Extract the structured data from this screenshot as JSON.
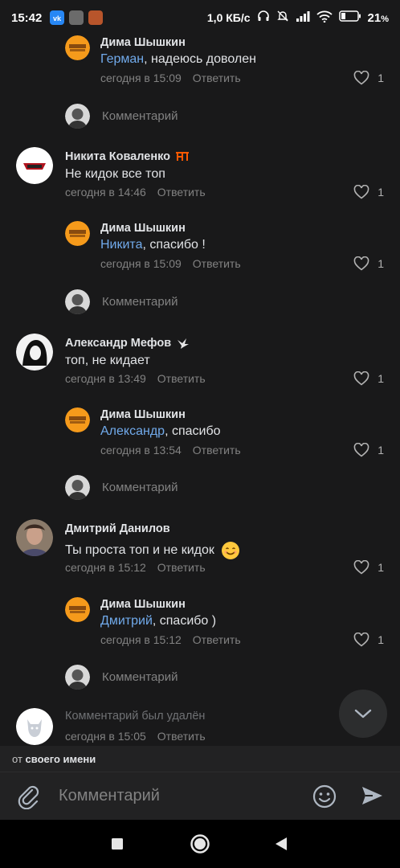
{
  "status": {
    "time": "15:42",
    "speed": "1,0 КБ/с",
    "battery": "21",
    "battery_unit": "%"
  },
  "comments": [
    {
      "author": "Дима Шышкин",
      "mention": "Герман",
      "text": ", надеюсь доволен",
      "meta": "сегодня в 15:09",
      "reply": "Ответить",
      "likes": "1"
    },
    {
      "author": "Никита Коваленко",
      "text": "Не кидок все топ",
      "meta": "сегодня в 14:46",
      "reply": "Ответить",
      "likes": "1"
    },
    {
      "author": "Дима Шышкин",
      "mention": "Никита",
      "text": ", спасибо !",
      "meta": "сегодня в 15:09",
      "reply": "Ответить",
      "likes": "1"
    },
    {
      "author": "Александр Мефов",
      "text": "топ, не кидает",
      "meta": "сегодня в 13:49",
      "reply": "Ответить",
      "likes": "1"
    },
    {
      "author": "Дима Шышкин",
      "mention": "Александр",
      "text": ", спасибо",
      "meta": "сегодня в 13:54",
      "reply": "Ответить",
      "likes": "1"
    },
    {
      "author": "Дмитрий Данилов",
      "text": "Ты проста топ и не кидок",
      "meta": "сегодня в 15:12",
      "reply": "Ответить",
      "likes": "1"
    },
    {
      "author": "Дима Шышкин",
      "mention": "Дмитрий",
      "text": ", спасибо )",
      "meta": "сегодня в 15:12",
      "reply": "Ответить",
      "likes": "1"
    },
    {
      "text": "Комментарий был удалён",
      "meta": "сегодня в 15:05",
      "reply": "Ответить"
    }
  ],
  "reply_prompt": "Комментарий",
  "from_bar": {
    "prefix": "от",
    "name": "своего имени"
  },
  "composer": {
    "placeholder": "Комментарий"
  },
  "colors": {
    "background": "#19191a",
    "mention": "#71aaeb",
    "secondary_text": "#828282"
  }
}
